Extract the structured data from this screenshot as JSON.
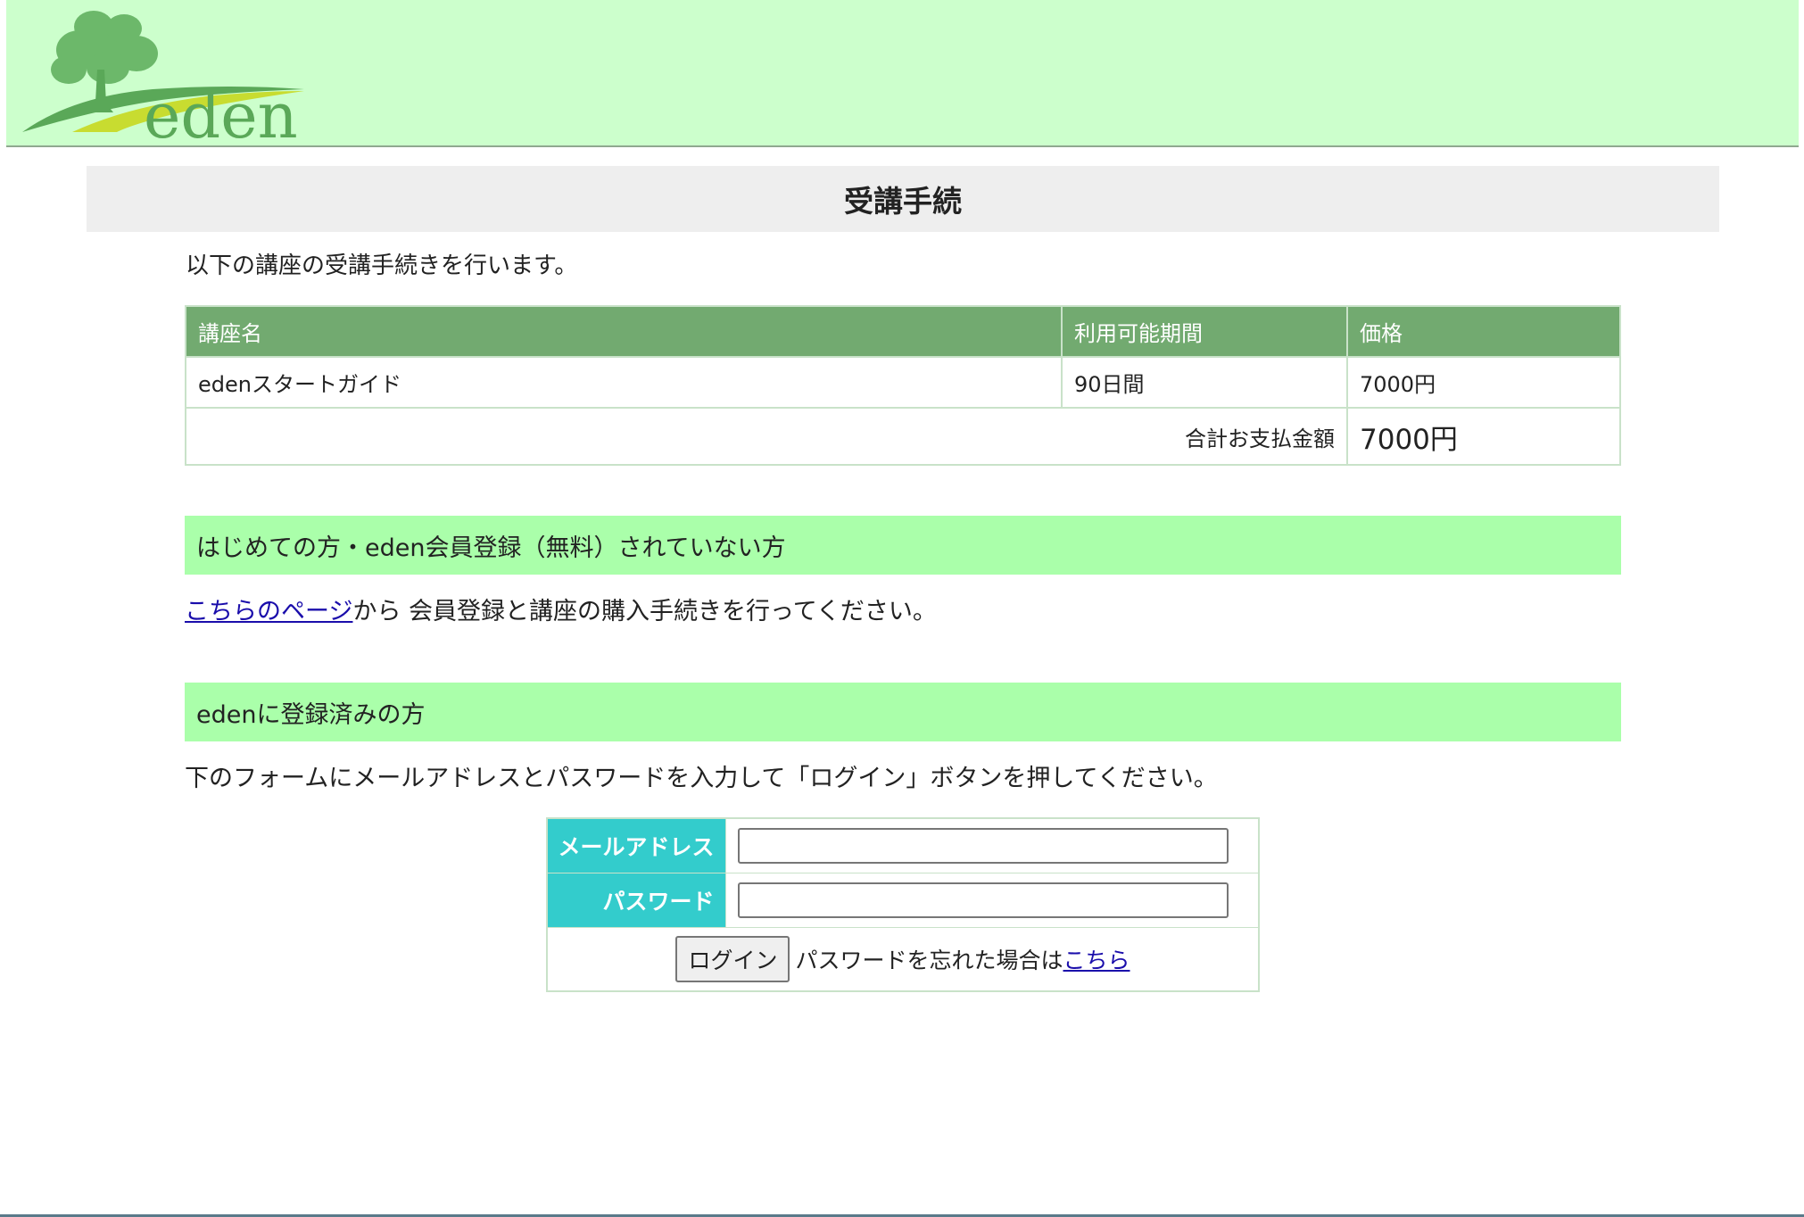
{
  "header": {
    "logo_text": "eden"
  },
  "page": {
    "title": "受講手続",
    "intro": "以下の講座の受講手続きを行います。"
  },
  "course_table": {
    "headers": [
      "講座名",
      "利用可能期間",
      "価格"
    ],
    "rows": [
      {
        "name": "edenスタートガイド",
        "period": "90日間",
        "price": "7000円"
      }
    ],
    "total_label": "合計お支払金額",
    "total_value": "7000円"
  },
  "new_member": {
    "heading": "はじめての方・eden会員登録（無料）されていない方",
    "link_text": "こちらのページ",
    "text_after": "から 会員登録と講座の購入手続きを行ってください。"
  },
  "registered": {
    "heading": "edenに登録済みの方",
    "instruction": "下のフォームにメールアドレスとパスワードを入力して「ログイン」ボタンを押してください。"
  },
  "login_form": {
    "email_label": "メールアドレス",
    "email_value": "",
    "password_label": "パスワード",
    "password_value": "",
    "login_button": "ログイン",
    "forgot_text": "パスワードを忘れた場合は",
    "forgot_link": "こちら"
  },
  "colors": {
    "header_bg": "#ccffcc",
    "section_bg": "#aaffaa",
    "table_header_bg": "#72aa70",
    "form_label_bg": "#33cccc",
    "link": "#1a0dab"
  }
}
